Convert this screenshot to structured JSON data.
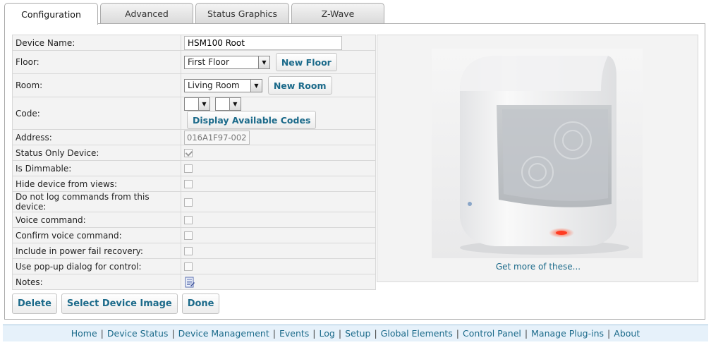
{
  "tabs": [
    {
      "label": "Configuration"
    },
    {
      "label": "Advanced"
    },
    {
      "label": "Status Graphics"
    },
    {
      "label": "Z-Wave"
    }
  ],
  "form": {
    "device_name": {
      "label": "Device Name:",
      "value": "HSM100 Root"
    },
    "floor": {
      "label": "Floor:",
      "selected": "First Floor",
      "button": "New Floor"
    },
    "room": {
      "label": "Room:",
      "selected": "Living Room",
      "button": "New Room"
    },
    "code": {
      "label": "Code:",
      "selected_1": "",
      "selected_2": "",
      "button": "Display Available Codes"
    },
    "address": {
      "label": "Address:",
      "value": "016A1F97-002"
    },
    "status_only": {
      "label": "Status Only Device:",
      "checked": true
    },
    "dimmable": {
      "label": "Is Dimmable:",
      "checked": false
    },
    "hide": {
      "label": "Hide device from views:",
      "checked": false
    },
    "no_log": {
      "label": "Do not log commands from this device:",
      "checked": false
    },
    "voice": {
      "label": "Voice command:",
      "checked": false
    },
    "confirm_voice": {
      "label": "Confirm voice command:",
      "checked": false
    },
    "power_fail": {
      "label": "Include in power fail recovery:",
      "checked": false
    },
    "popup": {
      "label": "Use pop-up dialog for control:",
      "checked": false
    },
    "notes": {
      "label": "Notes:"
    }
  },
  "image_panel": {
    "get_more": "Get more of these..."
  },
  "actions": {
    "delete": "Delete",
    "select_image": "Select Device Image",
    "done": "Done"
  },
  "footer": {
    "links": [
      "Home",
      "Device Status",
      "Device Management",
      "Events",
      "Log",
      "Setup",
      "Global Elements",
      "Control Panel",
      "Manage Plug-ins",
      "About"
    ]
  }
}
